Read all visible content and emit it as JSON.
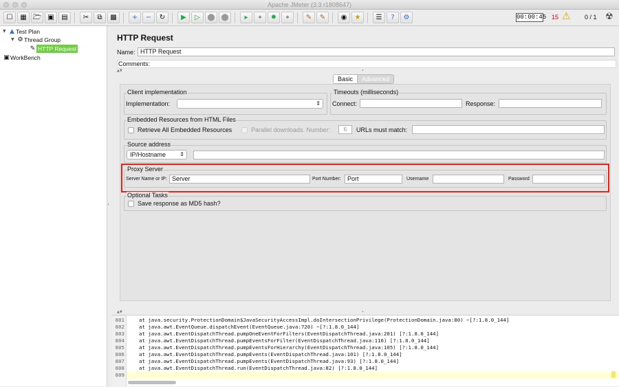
{
  "window": {
    "title": "Apache JMeter (3.3 r1808647)"
  },
  "toolbar": {
    "icons": [
      "new-icon",
      "templates-icon",
      "open-icon",
      "save-icon",
      "save-as-icon",
      "cut-icon",
      "copy-icon",
      "paste-icon",
      "expand-icon",
      "collapse-icon",
      "toggle-icon",
      "start-icon",
      "start-no-pause-icon",
      "stop-icon",
      "shutdown-icon",
      "remote-start-icon",
      "remote-stop-icon",
      "remote-start-all-icon",
      "remote-stop-all-icon",
      "clear-icon",
      "clear-all-icon",
      "search-icon",
      "reset-search-icon",
      "function-helper-icon",
      "help-icon",
      "log-viewer-icon"
    ],
    "timer": "00:00:45",
    "error_count": "15",
    "threads": "0 / 1"
  },
  "tree": {
    "items": [
      {
        "label": "Test Plan",
        "icon": "test-plan-icon"
      },
      {
        "label": "Thread Group",
        "icon": "thread-group-icon"
      },
      {
        "label": "HTTP Request",
        "icon": "sampler-icon"
      },
      {
        "label": "WorkBench",
        "icon": "workbench-icon"
      }
    ]
  },
  "panel": {
    "title": "HTTP Request",
    "name_label": "Name:",
    "name_value": "HTTP Request",
    "comments_label": "Comments:",
    "tabs": [
      "Basic",
      "Advanced"
    ]
  },
  "client": {
    "legend": "Client implementation",
    "impl_label": "Implementation:",
    "impl_value": ""
  },
  "timeouts": {
    "legend": "Timeouts (milliseconds)",
    "connect_label": "Connect:",
    "response_label": "Response:"
  },
  "embedded": {
    "legend": "Embedded Resources from HTML Files",
    "retrieve_label": "Retrieve All Embedded Resources",
    "parallel_label": "Parallel downloads. Number:",
    "parallel_value": "6",
    "urls_label": "URLs must match:"
  },
  "source": {
    "legend": "Source address",
    "type_value": "IP/Hostname"
  },
  "proxy": {
    "legend": "Proxy Server",
    "server_label": "Server Name or IP:",
    "server_value": "Server",
    "port_label": "Port Number:",
    "port_value": "Port",
    "username_label": "Username",
    "password_label": "Password",
    "highlight_color": "#e2231a"
  },
  "optional": {
    "legend": "Optional Tasks",
    "md5_label": "Save response as MD5 hash?"
  },
  "log": {
    "lines": [
      {
        "n": "801",
        "text": "at java.security.ProtectionDomain$JavaSecurityAccessImpl.doIntersectionPrivilege(ProtectionDomain.java:80) ~[?:1.8.0_144]"
      },
      {
        "n": "802",
        "text": "at java.awt.EventQueue.dispatchEvent(EventQueue.java:720) ~[?:1.8.0_144]"
      },
      {
        "n": "803",
        "text": "at java.awt.EventDispatchThread.pumpOneEventForFilters(EventDispatchThread.java:201) [?:1.8.0_144]"
      },
      {
        "n": "804",
        "text": "at java.awt.EventDispatchThread.pumpEventsForFilter(EventDispatchThread.java:116) [?:1.8.0_144]"
      },
      {
        "n": "805",
        "text": "at java.awt.EventDispatchThread.pumpEventsForHierarchy(EventDispatchThread.java:105) [?:1.8.0_144]"
      },
      {
        "n": "806",
        "text": "at java.awt.EventDispatchThread.pumpEvents(EventDispatchThread.java:101) [?:1.8.0_144]"
      },
      {
        "n": "807",
        "text": "at java.awt.EventDispatchThread.pumpEvents(EventDispatchThread.java:93) [?:1.8.0_144]"
      },
      {
        "n": "808",
        "text": "at java.awt.EventDispatchThread.run(EventDispatchThread.java:82) [?:1.8.0_144]"
      },
      {
        "n": "809",
        "text": ""
      }
    ]
  }
}
